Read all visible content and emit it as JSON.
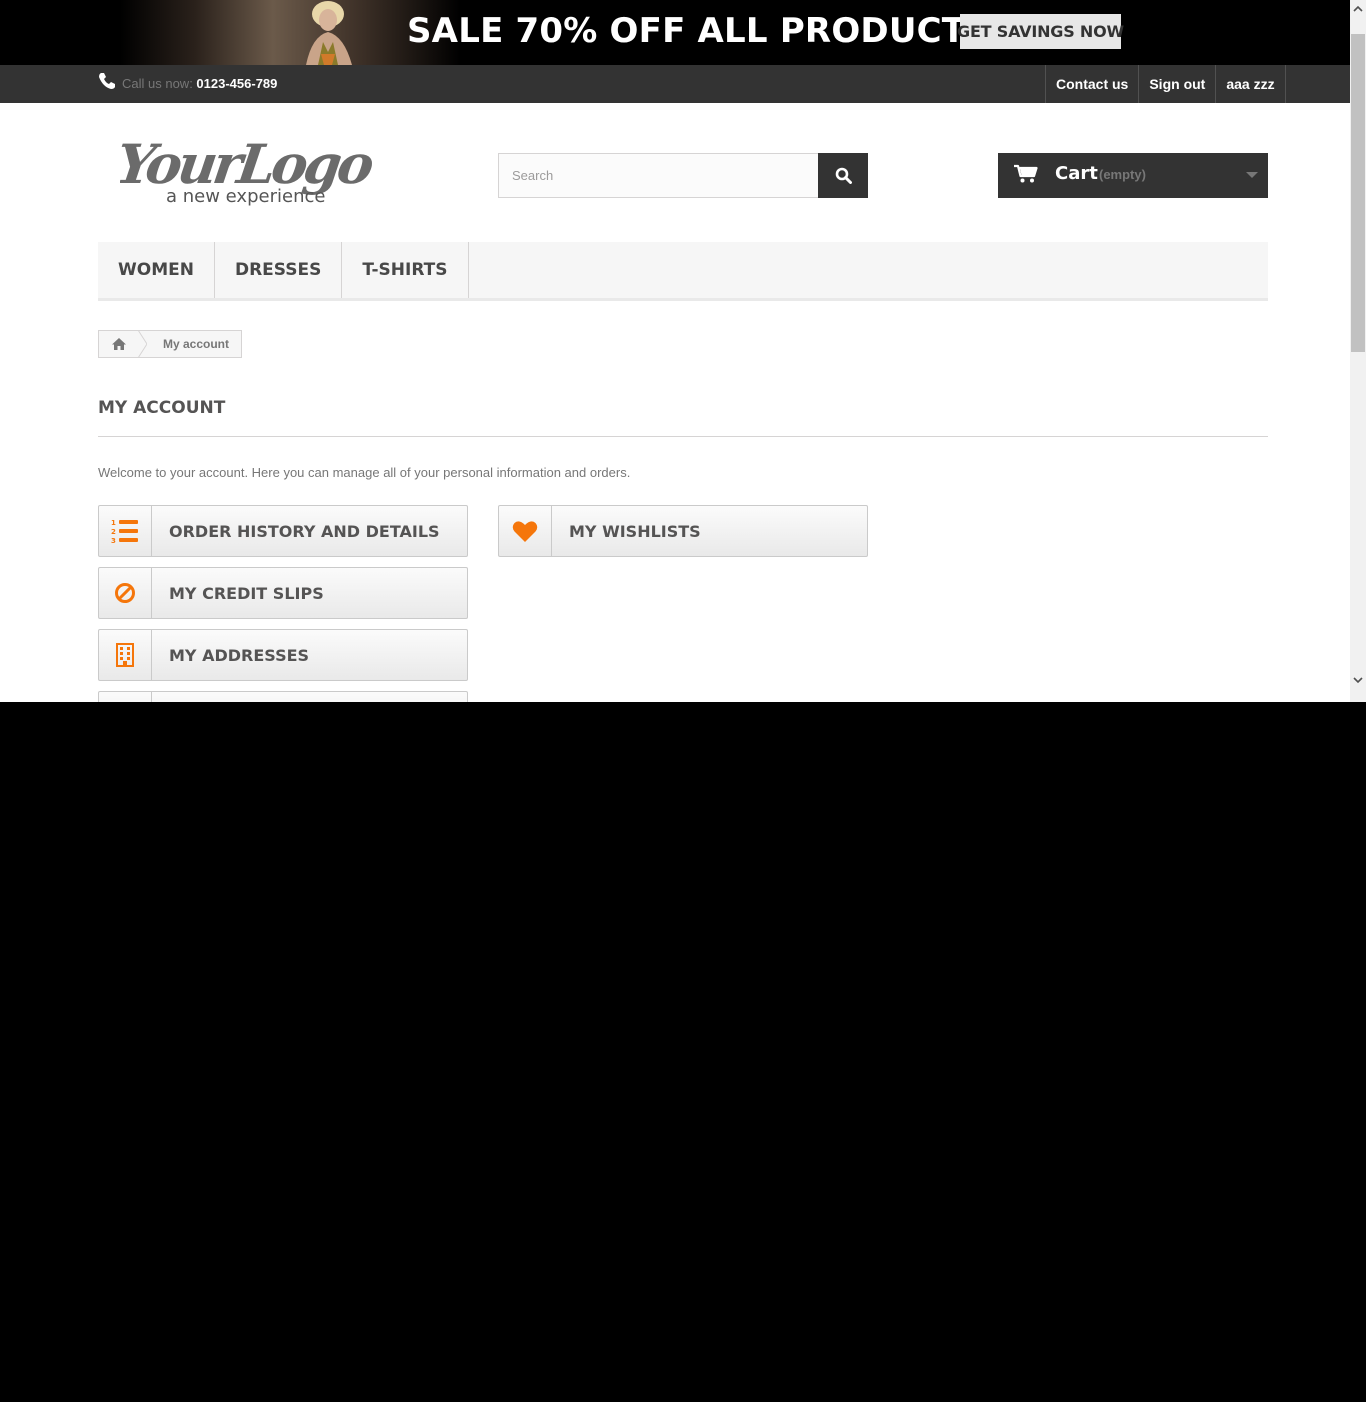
{
  "banner": {
    "headline": "SALE 70% OFF ALL PRODUCTS",
    "cta_label": "GET SAVINGS NOW"
  },
  "topbar": {
    "call_prefix": "Call us now: ",
    "phone": "0123-456-789",
    "links": [
      "Contact us",
      "Sign out",
      "aaa zzz"
    ]
  },
  "header": {
    "logo_main": "YourLogo",
    "logo_tagline": "a new experience",
    "search_placeholder": "Search",
    "cart_label": "Cart",
    "cart_status": "(empty)"
  },
  "menu": {
    "items": [
      "WOMEN",
      "DRESSES",
      "T-SHIRTS"
    ]
  },
  "breadcrumb": {
    "current": "My account"
  },
  "page": {
    "title": "MY ACCOUNT",
    "welcome": "Welcome to your account. Here you can manage all of your personal information and orders."
  },
  "account_links": {
    "order_history": "ORDER HISTORY AND DETAILS",
    "credit_slips": "MY CREDIT SLIPS",
    "addresses": "MY ADDRESSES",
    "wishlists": "MY WISHLISTS"
  },
  "colors": {
    "accent": "#f5760b",
    "dark_bar": "#333333",
    "text": "#555454"
  },
  "icons": {
    "phone": "phone-icon",
    "search": "search-icon",
    "cart": "cart-icon",
    "home": "home-icon",
    "order_history": "numbered-list-icon",
    "credit_slips": "ban-icon",
    "addresses": "building-icon",
    "wishlists": "heart-icon"
  }
}
